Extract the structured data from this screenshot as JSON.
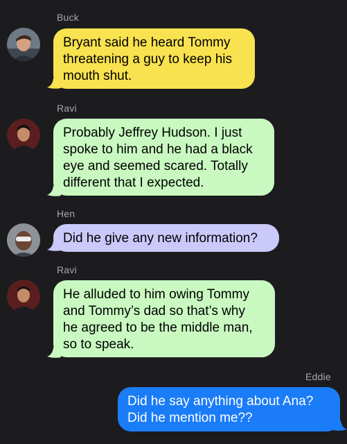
{
  "messages": [
    {
      "sender": "Buck",
      "text": "Bryant said he heard Tommy\nthreatening a guy to keep his\nmouth shut.",
      "color": "#f8e24f",
      "avatar": "buck-avatar"
    },
    {
      "sender": "Ravi",
      "text": "Probably Jeffrey Hudson. I just\nspoke to him and he had a black\neye and seemed scared. Totally\ndifferent that I expected.",
      "color": "#c9f9c1",
      "avatar": "ravi-avatar"
    },
    {
      "sender": "Hen",
      "text": "Did he give any new information?",
      "color": "#cbc8fa",
      "avatar": "hen-avatar"
    },
    {
      "sender": "Ravi",
      "text": "He alluded to him owing Tommy\nand Tommy’s dad so that’s why\nhe agreed to be the middle man,\nso to speak.",
      "color": "#c9f9c1",
      "avatar": "ravi-avatar"
    },
    {
      "sender": "Eddie",
      "text": "Did he say anything about Ana?\nDid he mention me??",
      "color": "#1b7cf7",
      "avatar": ""
    }
  ],
  "colors": {
    "background": "#1c1c1e",
    "sender_label": "#a7a7ac",
    "outgoing": "#1b7cf7"
  }
}
